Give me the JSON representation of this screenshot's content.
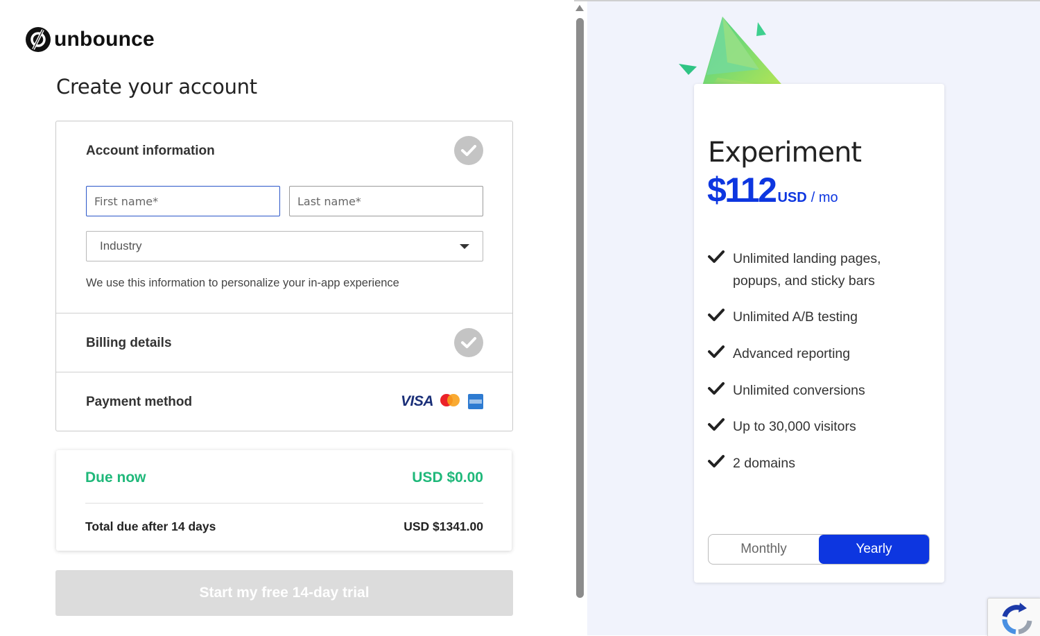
{
  "brand": {
    "name": "unbounce"
  },
  "page": {
    "title": "Create your account"
  },
  "account_section": {
    "heading": "Account information",
    "first_name_placeholder": "First name*",
    "last_name_placeholder": "Last name*",
    "industry_selected": "Industry",
    "hint": "We use this information to personalize your in-app experience"
  },
  "billing_section": {
    "heading": "Billing details"
  },
  "payment_section": {
    "heading": "Payment method",
    "card_brands": [
      "VISA",
      "mastercard-icon",
      "amex-icon"
    ],
    "visa_label": "VISA"
  },
  "summary": {
    "due_now_label": "Due now",
    "due_now_value": "USD $0.00",
    "total_label": "Total due after 14 days",
    "total_value": "USD $1341.00"
  },
  "cta": {
    "label": "Start my free 14-day trial"
  },
  "plan": {
    "name": "Experiment",
    "amount": "$112",
    "currency": "USD",
    "period": "/ mo",
    "features": [
      "Unlimited landing pages, popups, and sticky bars",
      "Unlimited A/B testing",
      "Advanced reporting",
      "Unlimited conversions",
      "Up to 30,000 visitors",
      "2 domains"
    ],
    "billing_toggle": {
      "options": [
        "Monthly",
        "Yearly"
      ],
      "selected": "Yearly"
    }
  },
  "colors": {
    "accent_blue": "#0d36e0",
    "due_green": "#1fb87a",
    "right_panel_bg": "#f1f3fc",
    "cta_disabled": "#dcdcdc"
  }
}
